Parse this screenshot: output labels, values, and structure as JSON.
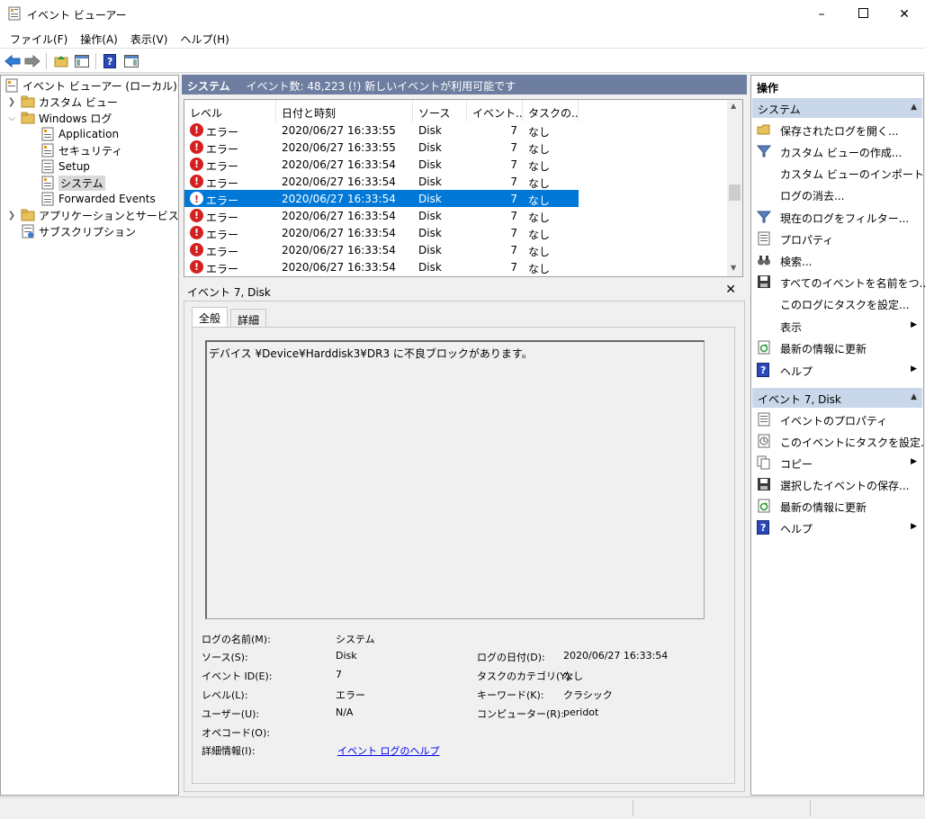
{
  "window": {
    "title": "イベント ビューアー",
    "controls": [
      "minimize",
      "maximize",
      "close"
    ]
  },
  "menu": [
    "ファイル(F)",
    "操作(A)",
    "表示(V)",
    "ヘルプ(H)"
  ],
  "toolbar": [
    "back-arrow-icon",
    "forward-arrow-icon",
    "folder-up-icon",
    "show-hide-tree-icon",
    "help-icon",
    "show-hide-action-pane-icon"
  ],
  "tree": {
    "root": "イベント ビューアー (ローカル)",
    "custom_views": "カスタム ビュー",
    "windows_logs": "Windows ログ",
    "logs": [
      "Application",
      "セキュリティ",
      "Setup",
      "システム",
      "Forwarded Events"
    ],
    "app_services": "アプリケーションとサービス ログ",
    "subscriptions": "サブスクリプション"
  },
  "center": {
    "header_title": "システム",
    "header_info": "イベント数: 48,223 (!) 新しいイベントが利用可能です",
    "columns": [
      "レベル",
      "日付と時刻",
      "ソース",
      "イベント...",
      "タスクの..."
    ],
    "events": [
      {
        "level": "エラー",
        "datetime": "2020/06/27 16:33:55",
        "source": "Disk",
        "id": "7",
        "task": "なし"
      },
      {
        "level": "エラー",
        "datetime": "2020/06/27 16:33:55",
        "source": "Disk",
        "id": "7",
        "task": "なし"
      },
      {
        "level": "エラー",
        "datetime": "2020/06/27 16:33:54",
        "source": "Disk",
        "id": "7",
        "task": "なし"
      },
      {
        "level": "エラー",
        "datetime": "2020/06/27 16:33:54",
        "source": "Disk",
        "id": "7",
        "task": "なし"
      },
      {
        "level": "エラー",
        "datetime": "2020/06/27 16:33:54",
        "source": "Disk",
        "id": "7",
        "task": "なし"
      },
      {
        "level": "エラー",
        "datetime": "2020/06/27 16:33:54",
        "source": "Disk",
        "id": "7",
        "task": "なし"
      },
      {
        "level": "エラー",
        "datetime": "2020/06/27 16:33:54",
        "source": "Disk",
        "id": "7",
        "task": "なし"
      },
      {
        "level": "エラー",
        "datetime": "2020/06/27 16:33:54",
        "source": "Disk",
        "id": "7",
        "task": "なし"
      },
      {
        "level": "エラー",
        "datetime": "2020/06/27 16:33:54",
        "source": "Disk",
        "id": "7",
        "task": "なし"
      }
    ],
    "selected_index": 4
  },
  "detail": {
    "title": "イベント 7, Disk",
    "tabs": [
      "全般",
      "詳細"
    ],
    "description": "デバイス ¥Device¥Harddisk3¥DR3 に不良ブロックがあります。",
    "fields": {
      "log_name_label": "ログの名前(M):",
      "log_name": "システム",
      "source_label": "ソース(S):",
      "source": "Disk",
      "logged_label": "ログの日付(D):",
      "logged": "2020/06/27 16:33:54",
      "event_id_label": "イベント ID(E):",
      "event_id": "7",
      "task_cat_label": "タスクのカテゴリ(Y):",
      "task_cat": "なし",
      "level_label": "レベル(L):",
      "level": "エラー",
      "keywords_label": "キーワード(K):",
      "keywords": "クラシック",
      "user_label": "ユーザー(U):",
      "user": "N/A",
      "computer_label": "コンピューター(R):",
      "computer": "peridot",
      "opcode_label": "オペコード(O):",
      "more_info_label": "詳細情報(I):",
      "more_info_link": "イベント ログのヘルプ"
    }
  },
  "actions": {
    "title": "操作",
    "section1": "システム",
    "items1": [
      "保存されたログを開く...",
      "カスタム ビューの作成...",
      "カスタム ビューのインポート...",
      "ログの消去...",
      "現在のログをフィルター...",
      "プロパティ",
      "検索...",
      "すべてのイベントを名前をつ...",
      "このログにタスクを設定...",
      "表示",
      "最新の情報に更新",
      "ヘルプ"
    ],
    "section2": "イベント 7, Disk",
    "items2": [
      "イベントのプロパティ",
      "このイベントにタスクを設定...",
      "コピー",
      "選択したイベントの保存...",
      "最新の情報に更新",
      "ヘルプ"
    ]
  }
}
